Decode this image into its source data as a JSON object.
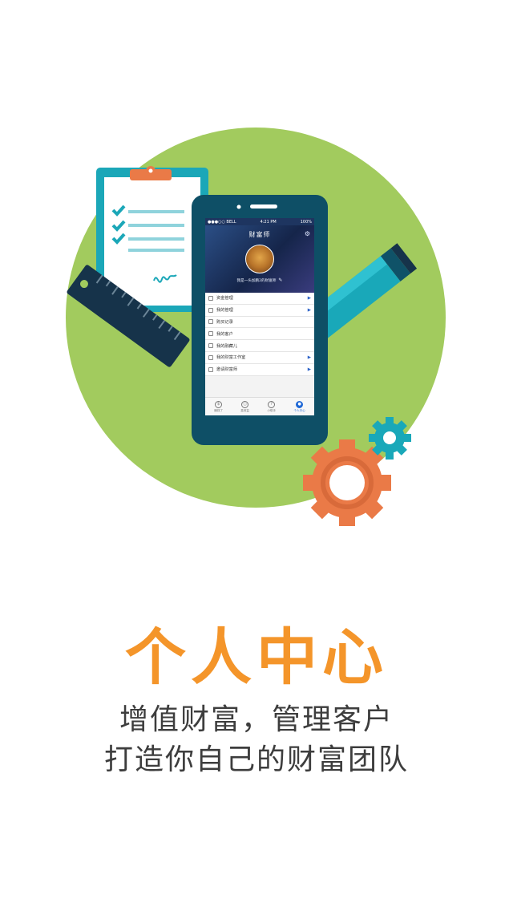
{
  "phone": {
    "status_carrier": "●●●○○ BELL",
    "status_time": "4:21 PM",
    "status_battery": "100%",
    "nav_title": "财富师",
    "motto": "我是一头加鹏2的财富师",
    "menu_items": [
      {
        "label": "资金管理",
        "has_arrow": true
      },
      {
        "label": "我的管理",
        "has_arrow": true
      },
      {
        "label": "购买记录",
        "has_arrow": false
      },
      {
        "label": "我的客户",
        "has_arrow": false
      },
      {
        "label": "我的融藏儿",
        "has_arrow": false
      },
      {
        "label": "我的财富工作室",
        "has_arrow": true
      },
      {
        "label": "邀请财富师",
        "has_arrow": true
      }
    ],
    "tabs": [
      {
        "label": "赚钱了"
      },
      {
        "label": "高收益"
      },
      {
        "label": "小助手"
      },
      {
        "label": "个人中心"
      }
    ]
  },
  "headline": "个人中心",
  "subtitle_line1": "增值财富，管理客户",
  "subtitle_line2": "打造你自己的财富团队",
  "colors": {
    "circle": "#a2cb5e",
    "phone": "#0e4f66",
    "accent": "#f4952a",
    "teal": "#19a8b9",
    "gear_orange": "#ea7a47"
  }
}
